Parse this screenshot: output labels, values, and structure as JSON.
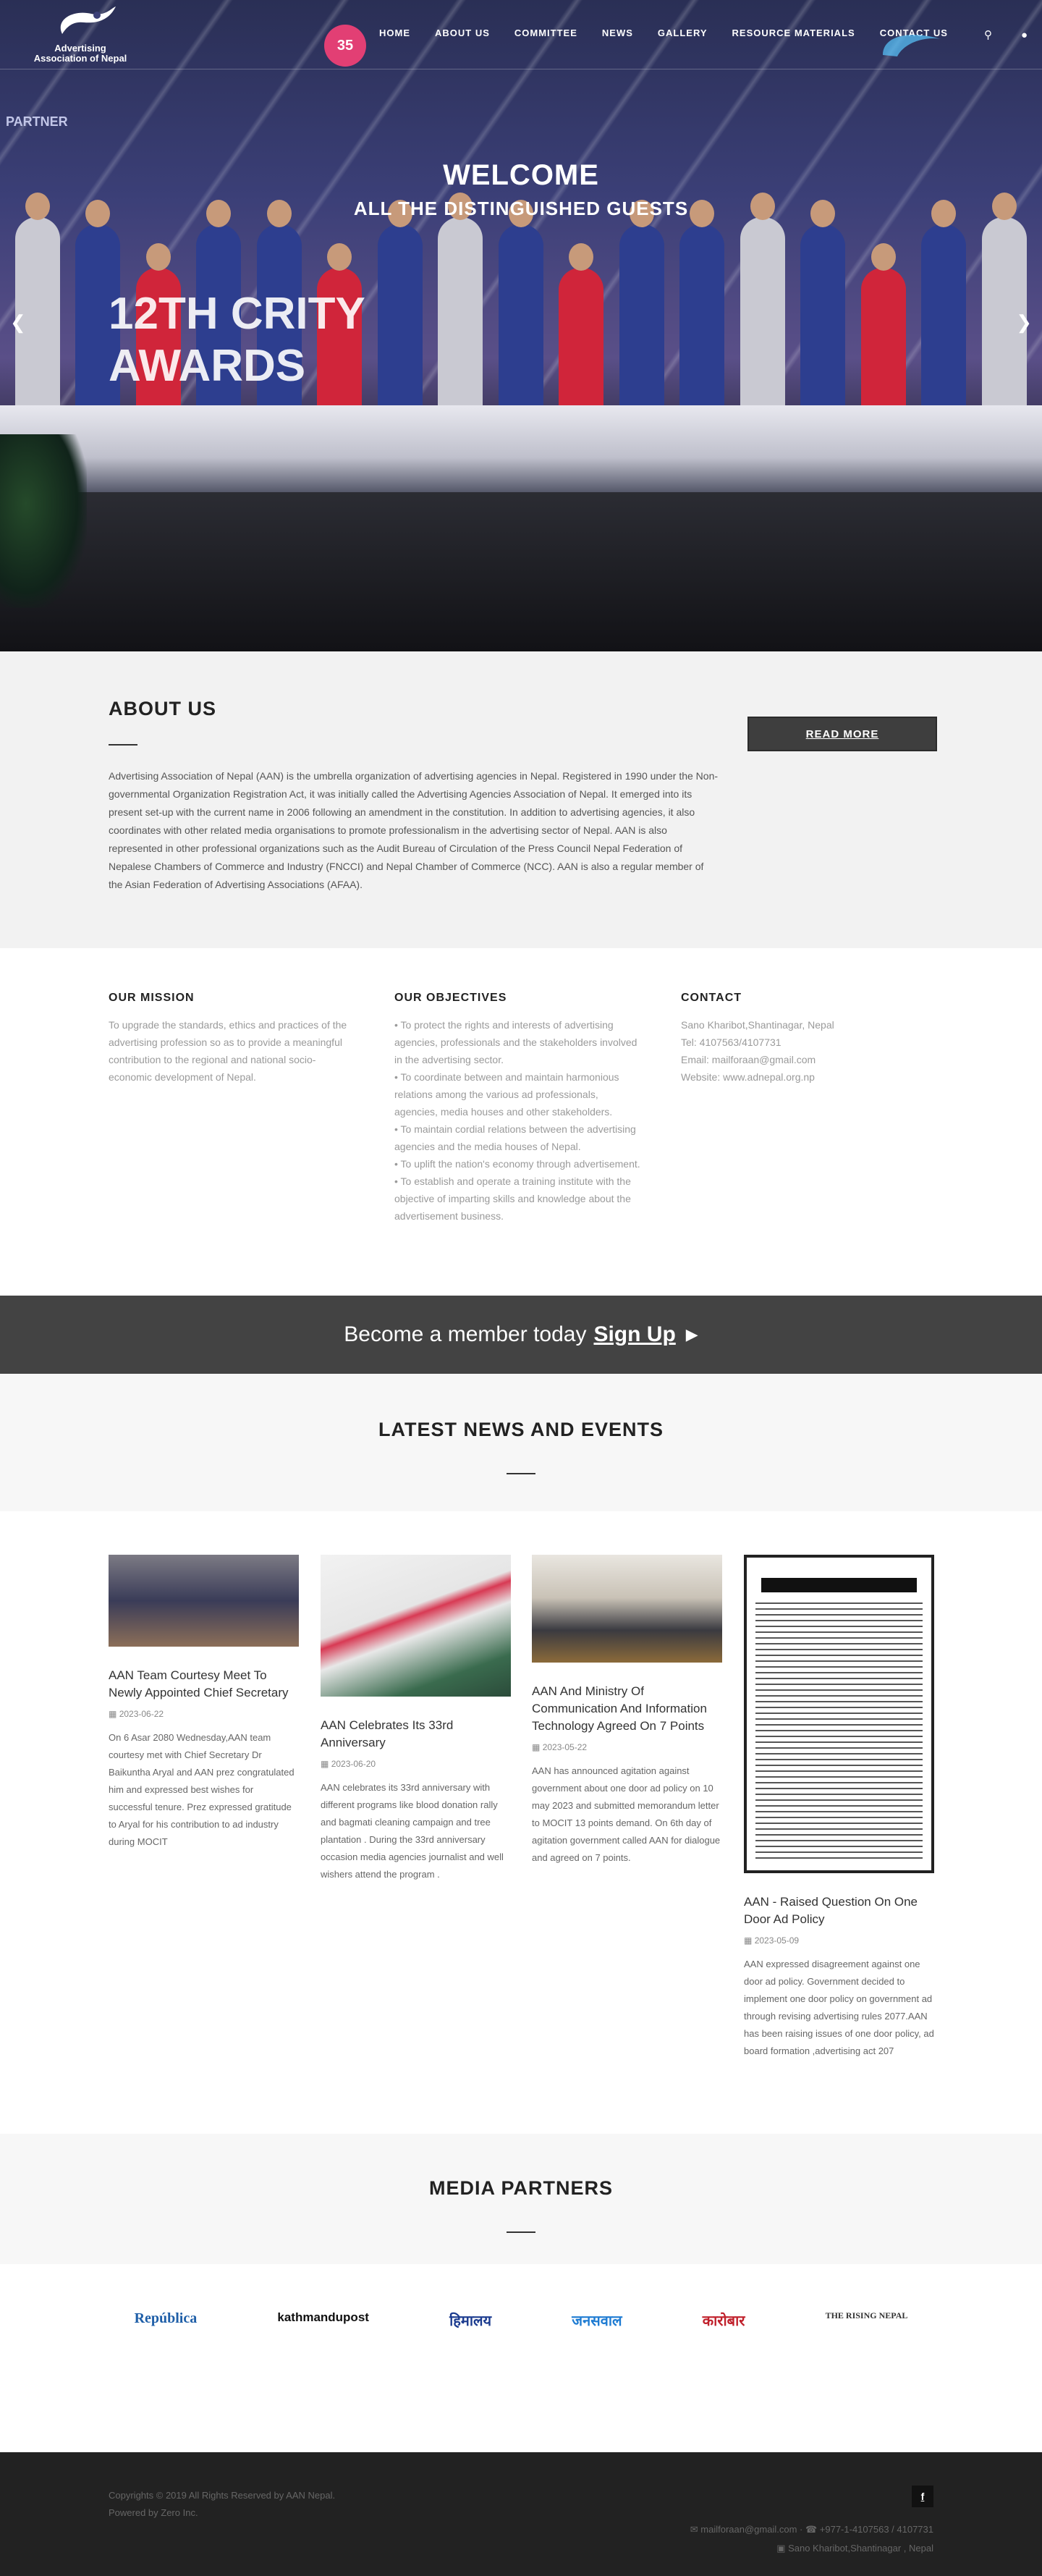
{
  "header": {
    "logo_line1": "Advertising",
    "logo_line2": "Association of Nepal",
    "badge_text": "35",
    "nav": [
      "HOME",
      "ABOUT US",
      "COMMITTEE",
      "NEWS",
      "GALLERY",
      "RESOURCE MATERIALS",
      "CONTACT US"
    ],
    "search_icon": "search-icon",
    "user_icon": "user-icon"
  },
  "hero": {
    "partner_tag": "PARTNER",
    "welcome": "WELCOME",
    "welcome_sub": "ALL THE DISTINGUISHED GUESTS",
    "title_line1": "12TH CRITY",
    "title_line2": "AWARDS"
  },
  "about": {
    "heading": "ABOUT US",
    "body": "Advertising Association of Nepal (AAN) is the umbrella organization of advertising agencies in Nepal. Registered in 1990 under the Non-governmental Organization Registration Act, it was initially called the Advertising Agencies Association of Nepal. It emerged into its present set-up with the current name in 2006 following an amendment in the constitution. In addition to advertising agencies, it also coordinates with other related media organisations to promote professionalism in the advertising sector of Nepal. AAN is also represented in other professional organizations such as the Audit Bureau of Circulation of the Press Council Nepal Federation of Nepalese Chambers of Commerce and Industry (FNCCI) and Nepal Chamber of Commerce (NCC). AAN is also a regular member of the Asian Federation of Advertising Associations (AFAA).",
    "read_more": "READ MORE"
  },
  "mission": {
    "heading": "OUR MISSION",
    "body": "To upgrade the standards, ethics and practices of the advertising profession so as to provide a meaningful contribution to the regional and national socio-economic development of Nepal."
  },
  "objectives": {
    "heading": "OUR OBJECTIVES",
    "items": [
      "To protect the rights and interests of advertising agencies, professionals and the stakeholders involved in the advertising sector.",
      "To coordinate between and maintain harmonious relations among the various ad professionals, agencies, media houses and other stakeholders.",
      "To maintain cordial relations between the advertising agencies and the media houses of Nepal.",
      "To uplift the nation's economy through advertisement.",
      "To establish and operate a training institute with the objective of imparting skills and knowledge about the advertisement business."
    ]
  },
  "contact": {
    "heading": "CONTACT",
    "address": "Sano Kharibot,Shantinagar, Nepal",
    "tel": "Tel: 4107563/4107731",
    "email": "Email: mailforaan@gmail.com",
    "website": "Website: www.adnepal.org.np"
  },
  "member": {
    "text": "Become a member today",
    "signup": "Sign Up"
  },
  "news": {
    "heading": "LATEST NEWS AND EVENTS",
    "cards": [
      {
        "title": "AAN Team Courtesy Meet To Newly Appointed Chief Secretary",
        "date": "2023-06-22",
        "excerpt": "On 6 Asar 2080 Wednesday,AAN team courtesy met with Chief Secretary Dr Baikuntha Aryal and AAN prez congratulated him and expressed best wishes for successful tenure. Prez expressed gratitude to Aryal for his contribution to ad industry during MOCIT"
      },
      {
        "title": "AAN Celebrates Its 33rd Anniversary",
        "date": "2023-06-20",
        "excerpt": "AAN celebrates its 33rd anniversary with different programs like blood donation rally and bagmati cleaning campaign and tree plantation . During the 33rd anniversary occasion media agencies journalist and well wishers attend the program ."
      },
      {
        "title": "AAN And Ministry Of Communication And Information Technology Agreed On 7 Points",
        "date": "2023-05-22",
        "excerpt": "AAN has announced agitation against government about one door ad policy on 10 may 2023 and submitted memorandum letter to MOCIT 13 points demand. On 6th day of agitation government called AAN for dialogue and agreed on 7 points."
      },
      {
        "title": "AAN - Raised Question On One Door Ad Policy",
        "date": "2023-05-09",
        "excerpt": "AAN expressed disagreement against one door ad policy. Government decided to implement one door policy on government ad through revising advertising rules 2077.AAN has been raising issues of one door policy, ad board formation ,advertising act 207"
      }
    ]
  },
  "partners": {
    "heading": "MEDIA PARTNERS",
    "items": [
      {
        "name": "República",
        "color": "#1f5fa8"
      },
      {
        "name": "kathmandupost",
        "color": "#111111"
      },
      {
        "name": "हिमालय",
        "color": "#1b3b8f"
      },
      {
        "name": "जनसवाल",
        "color": "#1e7bd2"
      },
      {
        "name": "कारोबार",
        "color": "#c0202b"
      },
      {
        "name": "THE RISING NEPAL",
        "color": "#333333"
      }
    ]
  },
  "footer": {
    "copyright": "Copyrights © 2019 All Rights Reserved by AAN Nepal.",
    "powered": "Powered by Zero Inc.",
    "fb": "f",
    "contact_line": "✉ mailforaan@gmail.com  ·  ☎ +977-1-4107563 / 4107731",
    "address_line": "▣ Sano Kharibot,Shantinagar , Nepal"
  },
  "colors": {
    "accent_dark": "#434343",
    "badge_pink": "#e23f74"
  }
}
